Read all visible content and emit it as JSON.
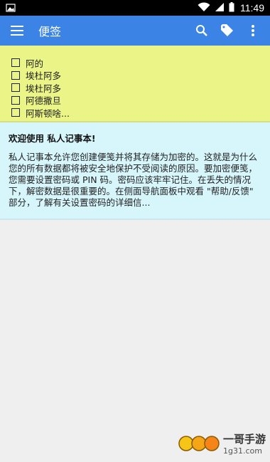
{
  "status_bar": {
    "time": "11:49"
  },
  "app_bar": {
    "title": "便签"
  },
  "notes": {
    "yellow": {
      "items": [
        {
          "label": "阿的"
        },
        {
          "label": "埃杜阿多"
        },
        {
          "label": "埃杜阿多"
        },
        {
          "label": "阿德撒旦"
        },
        {
          "label": "阿斯顿啥..."
        }
      ]
    },
    "cyan": {
      "title": "欢迎使用 私人记事本!",
      "body": "私人记事本允许您创建便笺并将其存储为加密的。这就是为什么您的所有数据都将被安全地保护不受阅读的原因。要加密便笺，您需要设置密码或 PIN 码。密码应该牢牢记住。在丢失的情况下，解密数据是很重要的。在侧面导航面板中观看 \"帮助/反馈\" 部分，了解有关设置密码的详细信..."
    }
  },
  "colors": {
    "app_bar": "#3b84e6",
    "yellow_note": "#ebf587",
    "cyan_note": "#d6f6fb",
    "background": "#efefef"
  },
  "watermark": {
    "site": "1g31.com",
    "label": "一哥手游"
  }
}
